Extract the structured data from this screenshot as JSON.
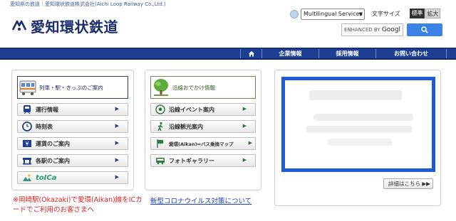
{
  "header": {
    "tagline": "愛知県の鉄道｜愛知環状鉄道株式会社(Aichi Loop Railway Co.,Ltd.)",
    "logo_text": "愛知環状鉄道",
    "language_select": "Multilingual Services",
    "font_size_label": "文字サイズ",
    "font_normal": "標準",
    "font_large": "拡大",
    "search_prefix": "ENHANCED BY",
    "search_brand": "Googl",
    "search_icon": "search-icon"
  },
  "nav": {
    "home_icon": "home-icon",
    "items": [
      "企業情報",
      "採用情報",
      "お問い合わせ"
    ]
  },
  "left_panel": {
    "feature_label": "列車・駅・きっぷのご案内",
    "buttons": [
      {
        "label": "運行情報",
        "icon": "train-icon"
      },
      {
        "label": "時刻表",
        "icon": "clock-icon"
      },
      {
        "label": "運賃のご案内",
        "icon": "fare-icon"
      },
      {
        "label": "各駅のご案内",
        "icon": "station-icon"
      },
      {
        "label": "toICa",
        "icon": "toica-logo"
      }
    ]
  },
  "mid_panel": {
    "feature_label": "沿線おでかけ情報",
    "buttons": [
      {
        "label": "沿線イベント案内",
        "icon": "event-icon"
      },
      {
        "label": "沿線観光案内",
        "icon": "walking-icon"
      },
      {
        "label": "愛環(Aikan)⇔バス乗換マップ",
        "icon": "flag-icon"
      },
      {
        "label": "フォトギャラリー",
        "icon": "bus-icon"
      }
    ]
  },
  "right_panel": {
    "detail_button": "詳細はこちら ▶▶"
  },
  "links": {
    "red_notice": "※岡崎駅(Okazaki)で愛環(Aikan)線をICカードでご利用のお客さまへ",
    "corona_notice": "新型コロナウイルス対策について"
  },
  "colors": {
    "brand_navy": "#1c3f93",
    "notice_blue": "#1d5bd8",
    "alert_red": "#e02020"
  }
}
